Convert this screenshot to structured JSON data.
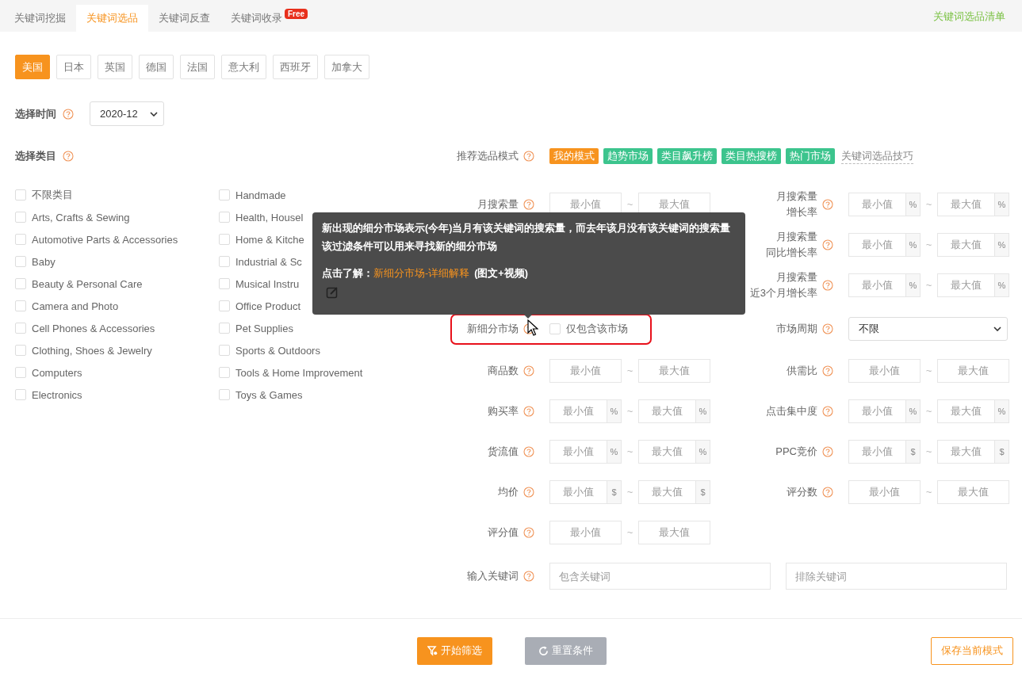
{
  "tabs": [
    {
      "label": "关键词挖掘",
      "selected": false
    },
    {
      "label": "关键词选品",
      "selected": true
    },
    {
      "label": "关键词反查",
      "selected": false
    },
    {
      "label": "关键词收录",
      "selected": false,
      "badge": "Free"
    }
  ],
  "top_link": "关键词选品清单",
  "countries": [
    {
      "label": "美国",
      "selected": true
    },
    {
      "label": "日本",
      "selected": false
    },
    {
      "label": "英国",
      "selected": false
    },
    {
      "label": "德国",
      "selected": false
    },
    {
      "label": "法国",
      "selected": false
    },
    {
      "label": "意大利",
      "selected": false
    },
    {
      "label": "西班牙",
      "selected": false
    },
    {
      "label": "加拿大",
      "selected": false
    }
  ],
  "time": {
    "label": "选择时间",
    "value": "2020-12"
  },
  "categories": {
    "label": "选择类目",
    "items": [
      {
        "label": "不限类目",
        "checked": false
      },
      {
        "label": "Arts, Crafts & Sewing",
        "checked": false
      },
      {
        "label": "Automotive Parts & Accessories",
        "checked": false
      },
      {
        "label": "Baby",
        "checked": false
      },
      {
        "label": "Beauty & Personal Care",
        "checked": false
      },
      {
        "label": "Camera and Photo",
        "checked": false
      },
      {
        "label": "Cell Phones & Accessories",
        "checked": false
      },
      {
        "label": "Clothing, Shoes & Jewelry",
        "checked": false
      },
      {
        "label": "Computers",
        "checked": false
      },
      {
        "label": "Electronics",
        "checked": false
      },
      {
        "label": "Handmade",
        "checked": false
      },
      {
        "label": "Health, Housel",
        "checked": false
      },
      {
        "label": "Home & Kitche",
        "checked": false
      },
      {
        "label": "Industrial & Sc",
        "checked": false
      },
      {
        "label": "Musical Instru",
        "checked": false
      },
      {
        "label": "Office Product",
        "checked": false
      },
      {
        "label": "Pet Supplies",
        "checked": false
      },
      {
        "label": "Sports & Outdoors",
        "checked": false
      },
      {
        "label": "Tools & Home Improvement",
        "checked": false
      },
      {
        "label": "Toys & Games",
        "checked": false
      }
    ]
  },
  "modes": {
    "label": "推荐选品模式",
    "tags": [
      {
        "label": "我的模式",
        "color": "#f7931e"
      },
      {
        "label": "趋势市场",
        "color": "#3cc48d"
      },
      {
        "label": "类目飙升榜",
        "color": "#3cc48d"
      },
      {
        "label": "类目热搜榜",
        "color": "#3cc48d"
      },
      {
        "label": "热门市场",
        "color": "#3cc48d"
      }
    ],
    "tips_link": "关键词选品技巧"
  },
  "filter_rows": [
    {
      "left": {
        "kind": "range",
        "label": [
          "月搜索量"
        ],
        "min_placeholder": "最小值",
        "sep": "~",
        "max_placeholder": "最大值"
      },
      "right": {
        "kind": "range",
        "label": [
          "月搜索量",
          "增长率"
        ],
        "min_placeholder": "最小值",
        "min_unit": "%",
        "sep": "~",
        "max_placeholder": "最大值",
        "max_unit": "%"
      }
    },
    {
      "right": {
        "kind": "range",
        "label": [
          "月搜索量",
          "同比增长率"
        ],
        "min_placeholder": "最小值",
        "min_unit": "%",
        "sep": "~",
        "max_placeholder": "最大值",
        "max_unit": "%"
      }
    },
    {
      "right": {
        "kind": "range",
        "label": [
          "月搜索量",
          "近3个月增长率"
        ],
        "min_placeholder": "最小值",
        "min_unit": "%",
        "sep": "~",
        "max_placeholder": "最大值",
        "max_unit": "%"
      }
    },
    {
      "left": {
        "kind": "checkbox",
        "label": [
          "新细分市场"
        ],
        "option": "仅包含该市场",
        "checked": false
      },
      "right": {
        "kind": "select",
        "label": [
          "市场周期"
        ],
        "value": "不限"
      }
    },
    {
      "left": {
        "kind": "range",
        "label": [
          "商品数"
        ],
        "min_placeholder": "最小值",
        "sep": "~",
        "max_placeholder": "最大值"
      },
      "right": {
        "kind": "range",
        "label": [
          "供需比"
        ],
        "min_placeholder": "最小值",
        "sep": "~",
        "max_placeholder": "最大值"
      }
    },
    {
      "left": {
        "kind": "range",
        "label": [
          "购买率"
        ],
        "min_placeholder": "最小值",
        "min_unit": "%",
        "sep": "~",
        "max_placeholder": "最大值",
        "max_unit": "%"
      },
      "right": {
        "kind": "range",
        "label": [
          "点击集中度"
        ],
        "min_placeholder": "最小值",
        "min_unit": "%",
        "sep": "~",
        "max_placeholder": "最大值",
        "max_unit": "%"
      }
    },
    {
      "left": {
        "kind": "range",
        "label": [
          "货流值"
        ],
        "min_placeholder": "最小值",
        "min_unit": "%",
        "sep": "~",
        "max_placeholder": "最大值",
        "max_unit": "%"
      },
      "right": {
        "kind": "range",
        "label": [
          "PPC竞价"
        ],
        "min_placeholder": "最小值",
        "min_unit": "$",
        "sep": "~",
        "max_placeholder": "最大值",
        "max_unit": "$"
      }
    },
    {
      "left": {
        "kind": "range",
        "label": [
          "均价"
        ],
        "min_placeholder": "最小值",
        "min_unit": "$",
        "sep": "~",
        "max_placeholder": "最大值",
        "max_unit": "$"
      },
      "right": {
        "kind": "range",
        "label": [
          "评分数"
        ],
        "min_placeholder": "最小值",
        "sep": "~",
        "max_placeholder": "最大值"
      }
    },
    {
      "left": {
        "kind": "range",
        "label": [
          "评分值"
        ],
        "min_placeholder": "最小值",
        "sep": "~",
        "max_placeholder": "最大值"
      }
    }
  ],
  "keywords": {
    "label": "输入关键词",
    "include_placeholder": "包含关键词",
    "exclude_placeholder": "排除关键词"
  },
  "tooltip": {
    "lines": [
      "新出现的细分市场表示(今年)当月有该关键词的搜索量，而去年该月没有该关键词的搜索量",
      "该过滤条件可以用来寻找新的细分市场"
    ],
    "link_label": "点击了解：",
    "link": "新细分市场-详细解释",
    "link_suffix": "(图文+视频)"
  },
  "buttons": [
    {
      "label": "开始筛选",
      "kind": "primary",
      "disabled": false
    },
    {
      "label": "重置条件",
      "kind": "reset",
      "disabled": true
    },
    {
      "label": "保存当前模式",
      "kind": "save",
      "disabled": false
    }
  ]
}
